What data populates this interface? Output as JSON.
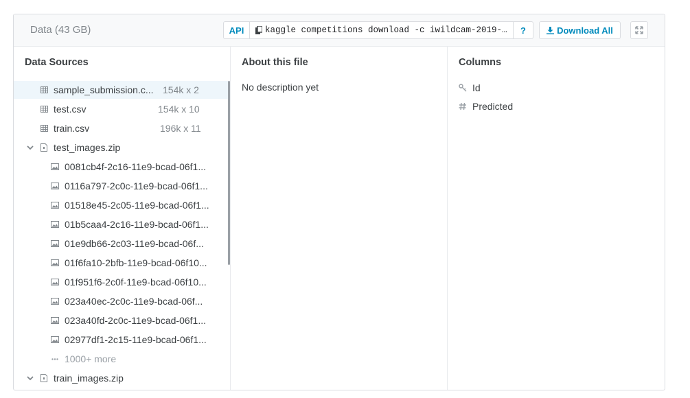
{
  "header": {
    "title": "Data (43 GB)",
    "api_label": "API",
    "command": "kaggle competitions download -c iwildcam-2019-fg…",
    "help_label": "?",
    "download_label": "Download All"
  },
  "sources": {
    "title": "Data Sources",
    "files": [
      {
        "name": "sample_submission.c...",
        "meta": "154k x 2"
      },
      {
        "name": "test.csv",
        "meta": "154k x 10"
      },
      {
        "name": "train.csv",
        "meta": "196k x 11"
      }
    ],
    "folder": {
      "name": "test_images.zip"
    },
    "images": [
      "0081cb4f-2c16-11e9-bcad-06f1...",
      "0116a797-2c0c-11e9-bcad-06f1...",
      "01518e45-2c05-11e9-bcad-06f1...",
      "01b5caa4-2c16-11e9-bcad-06f1...",
      "01e9db66-2c03-11e9-bcad-06f...",
      "01f6fa10-2bfb-11e9-bcad-06f10...",
      "01f951f6-2c0f-11e9-bcad-06f10...",
      "023a40ec-2c0c-11e9-bcad-06f...",
      "023a40fd-2c0c-11e9-bcad-06f1...",
      "02977df1-2c15-11e9-bcad-06f1..."
    ],
    "more_label": "1000+ more",
    "folder2": {
      "name": "train_images.zip"
    }
  },
  "about": {
    "title": "About this file",
    "text": "No description yet"
  },
  "columns": {
    "title": "Columns",
    "items": [
      {
        "name": "Id",
        "type_icon": "key-icon"
      },
      {
        "name": "Predicted",
        "type_icon": "hash-icon"
      }
    ]
  },
  "colors": {
    "accent": "#008abc",
    "selected_bg": "#eef6fb"
  }
}
